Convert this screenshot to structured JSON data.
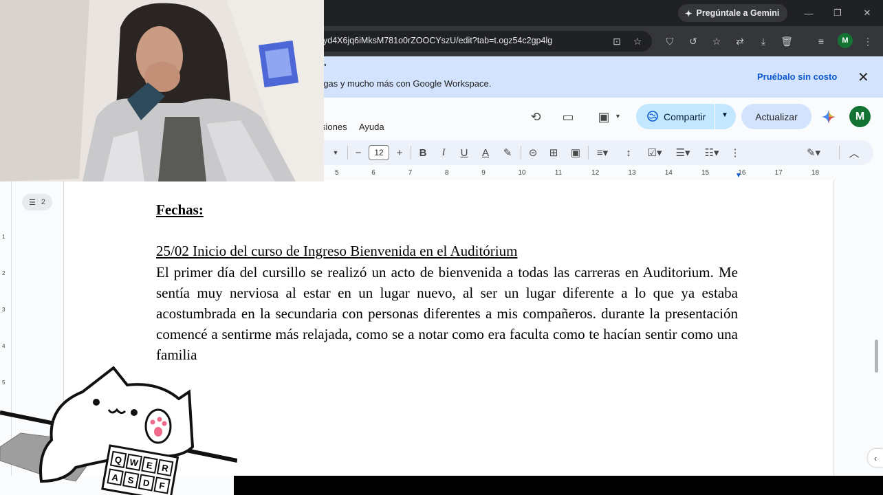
{
  "browser": {
    "gemini_button": "Pregúntale a Gemini",
    "url": "yd4X6jq6iMksM781o0rZOOCYszU/edit?tab=t.ogz54c2gp4lg",
    "profile_initial": "M"
  },
  "promo": {
    "line1": "\"",
    "line2": "rgas y mucho más con Google Workspace.",
    "cta": "Pruébalo sin costo"
  },
  "docs": {
    "menu_partial": "siones",
    "menu_help": "Ayuda",
    "share_label": "Compartir",
    "update_label": "Actualizar",
    "avatar_initial": "M",
    "font_size": "12",
    "outline_count": "2",
    "ruler_numbers": [
      "5",
      "6",
      "7",
      "8",
      "9",
      "10",
      "11",
      "12",
      "13",
      "14",
      "15",
      "16",
      "17",
      "18"
    ],
    "vruler_numbers": [
      "1",
      "2",
      "3",
      "4",
      "5"
    ]
  },
  "document": {
    "heading": "Fechas:",
    "entry_title": "25/02 Inicio del curso de Ingreso Bienvenida en el Auditórium",
    "entry_body": "El primer día del cursillo se realizó un acto de bienvenida a todas las carreras en Auditorium. Me sentía muy nerviosa al estar en un lugar nuevo, al ser un lugar diferente a lo que ya estaba acostumbrada en la secundaria con personas diferentes a mis compañeros. durante la presentación comencé a sentirme más relajada, como se a notar como era faculta como te hacían sentir como una familia"
  },
  "overlay": {
    "keyboard_keys": [
      "Q",
      "W",
      "E",
      "R",
      "A",
      "S",
      "D",
      "F"
    ]
  }
}
